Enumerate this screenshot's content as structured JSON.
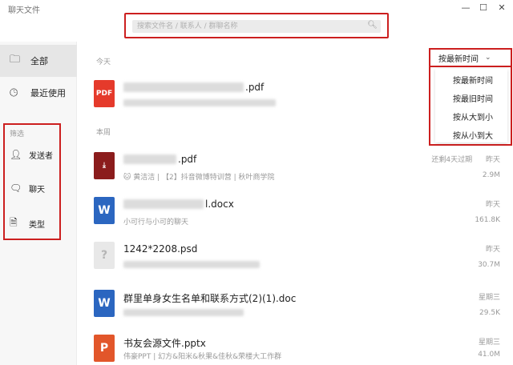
{
  "window": {
    "title": "聊天文件",
    "minimize": "—",
    "maximize": "☐",
    "close": "✕"
  },
  "search": {
    "placeholder": "搜索文件名 / 联系人 / 群聊名称",
    "icon": "search-icon"
  },
  "sidebar": {
    "items": [
      {
        "label": "全部",
        "icon": "folder-icon"
      },
      {
        "label": "最近使用",
        "icon": "clock-icon"
      }
    ],
    "filter_title": "筛选",
    "filters": [
      {
        "label": "发送者",
        "icon": "person-icon"
      },
      {
        "label": "聊天",
        "icon": "chat-bubble-icon"
      },
      {
        "label": "类型",
        "icon": "document-icon"
      }
    ]
  },
  "sort": {
    "current": "按最新时间",
    "options": [
      "按最新时间",
      "按最旧时间",
      "按从大到小",
      "按从小到大"
    ]
  },
  "sections": {
    "today": "今天",
    "this_week": "本周"
  },
  "files": [
    {
      "name": ".pdf",
      "icon_text": "PDF",
      "sub": "",
      "time": "",
      "size": ""
    },
    {
      "name": ".pdf",
      "icon_text": "⤓",
      "sub": "🐱 黄洁洁 | 【2】抖音微博特训营 | 秋叶商学院",
      "forward": "还剩4天过期",
      "time": "昨天",
      "size": "2.9M"
    },
    {
      "name": "l.docx",
      "icon_text": "W",
      "sub": "小可行与小可的聊天",
      "time": "昨天",
      "size": "161.8K"
    },
    {
      "name": "1242*2208.psd",
      "icon_text": "?",
      "sub": "",
      "time": "昨天",
      "size": "30.7M"
    },
    {
      "name": "群里单身女生名单和联系方式(2)(1).doc",
      "icon_text": "W",
      "sub": "",
      "time": "星期三",
      "size": "29.5K"
    },
    {
      "name": "书友会源文件.pptx",
      "icon_text": "P",
      "sub": "伟豪PPT | 幻方&阳米&秋果&佳秋&荣楼大工作群",
      "time": "星期三",
      "size": "41.0M"
    }
  ],
  "colors": {
    "highlight": "#cc1f1f",
    "pdf": "#e53a2b",
    "word": "#2b66c0",
    "ppt": "#e2562a"
  }
}
